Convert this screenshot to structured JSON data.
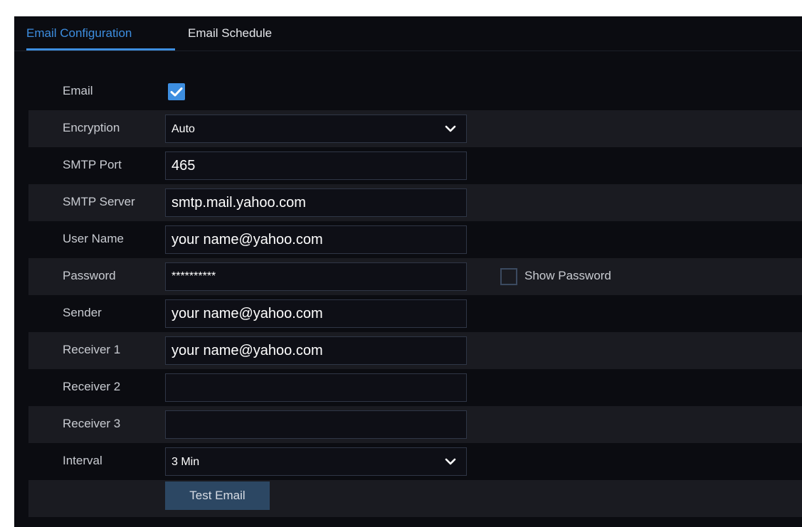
{
  "tabs": {
    "email_configuration": "Email Configuration",
    "email_schedule": "Email Schedule"
  },
  "form": {
    "email": {
      "label": "Email",
      "checked": true
    },
    "encryption": {
      "label": "Encryption",
      "value": "Auto"
    },
    "smtp_port": {
      "label": "SMTP Port",
      "value": "465"
    },
    "smtp_server": {
      "label": "SMTP Server",
      "value": "smtp.mail.yahoo.com"
    },
    "user_name": {
      "label": "User Name",
      "value": "your name@yahoo.com"
    },
    "password": {
      "label": "Password",
      "value": "**********",
      "show_password_label": "Show Password",
      "show_password_checked": false
    },
    "sender": {
      "label": "Sender",
      "value": "your name@yahoo.com"
    },
    "receiver_1": {
      "label": "Receiver 1",
      "value": "your name@yahoo.com"
    },
    "receiver_2": {
      "label": "Receiver 2",
      "value": ""
    },
    "receiver_3": {
      "label": "Receiver 3",
      "value": ""
    },
    "interval": {
      "label": "Interval",
      "value": "3 Min"
    },
    "test_button": "Test Email"
  },
  "icons": {
    "checkbox_check": "check-icon",
    "dropdown": "chevron-down-icon"
  },
  "colors": {
    "accent": "#3d8ee0",
    "background": "#0b0c11",
    "row_alt": "#1a1b21",
    "button": "#2c4763"
  }
}
